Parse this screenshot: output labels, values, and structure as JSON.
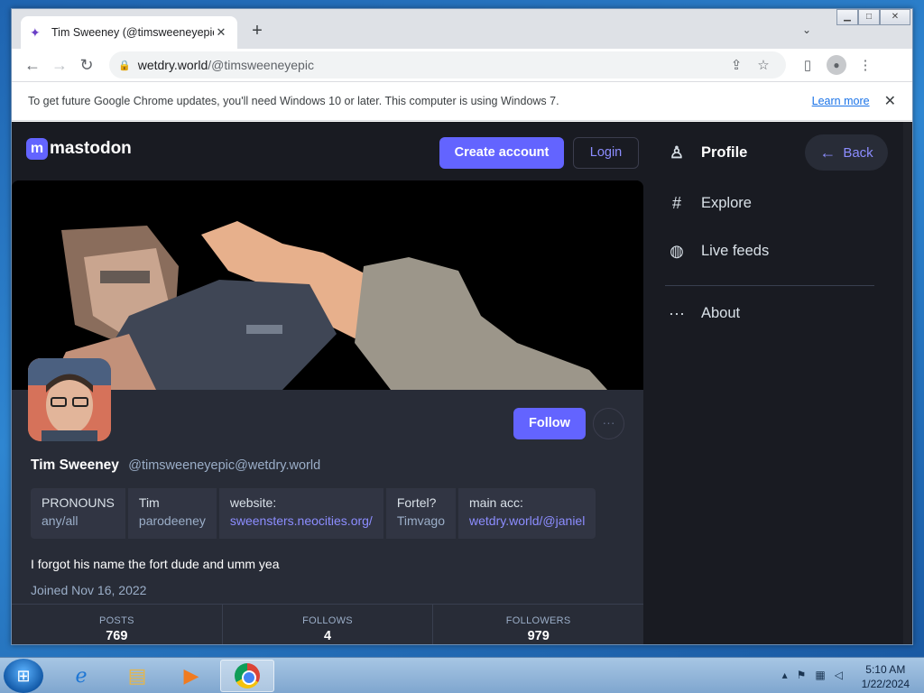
{
  "browser": {
    "tab_title": "Tim Sweeney (@timsweeneyepic",
    "tab_close": "✕",
    "new_tab": "+",
    "url_domain": "wetdry.world",
    "url_path": "/@timsweeneyepic",
    "infobar_message": "To get future Google Chrome updates, you'll need Windows 10 or later. This computer is using Windows 7.",
    "infobar_link": "Learn more",
    "infobar_close": "✕"
  },
  "mastodon": {
    "logo_text": "mastodon",
    "create_account": "Create account",
    "login": "Login",
    "follow": "Follow",
    "more": "···",
    "display_name": "Tim Sweeney",
    "acct": "@timsweeneyepic@wetdry.world",
    "fields": [
      {
        "k": "PRONOUNS",
        "v": "any/all",
        "link": false
      },
      {
        "k": "Tim",
        "v": "parodeeney",
        "link": false
      },
      {
        "k": "website:",
        "v": "sweensters.neocities.org/",
        "link": true
      },
      {
        "k": "Fortel?",
        "v": "Timvago",
        "link": false
      },
      {
        "k": "main acc:",
        "v": "wetdry.world/@janiel",
        "link": true
      }
    ],
    "bio": "I forgot his name the fort dude and umm yea",
    "joined": "Joined Nov 16, 2022",
    "stats": {
      "posts_label": "POSTS",
      "posts": "769",
      "follows_label": "FOLLOWS",
      "follows": "4",
      "followers_label": "FOLLOWERS",
      "followers": "979"
    }
  },
  "nav": {
    "profile": "Profile",
    "back": "Back",
    "explore": "Explore",
    "live_feeds": "Live feeds",
    "about": "About"
  },
  "taskbar": {
    "time": "5:10 AM",
    "date": "1/22/2024"
  },
  "colors": {
    "accent": "#6364ff",
    "page_bg": "#191b22",
    "card_bg": "#282c37"
  }
}
